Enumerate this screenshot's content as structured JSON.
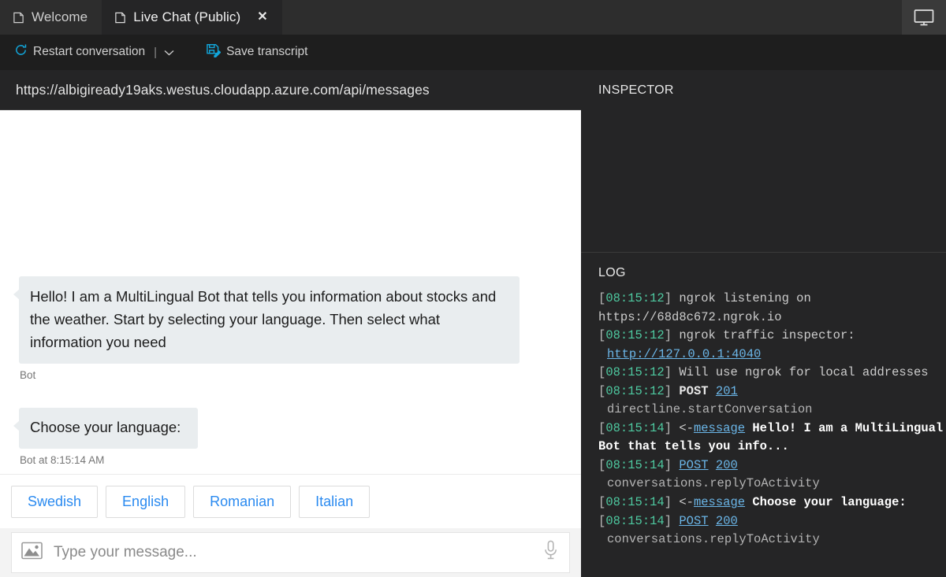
{
  "tabs": [
    {
      "label": "Welcome",
      "icon": "page-icon",
      "active": false,
      "closable": false
    },
    {
      "label": "Live Chat (Public)",
      "icon": "page-icon",
      "active": true,
      "closable": true,
      "close_glyph": "✕"
    }
  ],
  "titlebar": {
    "display_icon": "monitor-icon"
  },
  "toolbar": {
    "restart_label": "Restart conversation",
    "restart_icon": "refresh-icon",
    "separator": "|",
    "chevron": "⌄",
    "save_label": "Save transcript",
    "save_icon": "save-disk-icon",
    "accent": "#12a5d9"
  },
  "webchat": {
    "endpoint_url": "https://albigiready19aks.westus.cloudapp.azure.com/api/messages",
    "messages": [
      {
        "text": "Hello! I am a MultiLingual Bot that tells you information about stocks and the weather. Start by selecting your language. Then select what information you need",
        "meta": "Bot"
      },
      {
        "text": "Choose your language:",
        "meta": "Bot at 8:15:14 AM"
      }
    ],
    "suggested_actions": [
      "Swedish",
      "English",
      "Romanian",
      "Italian"
    ],
    "composer": {
      "upload_icon": "image-upload-icon",
      "placeholder": "Type your message...",
      "value": "",
      "mic_icon": "microphone-icon"
    }
  },
  "inspector": {
    "title": "INSPECTOR",
    "content": ""
  },
  "log": {
    "title": "LOG",
    "lines": [
      {
        "indent": false,
        "parts": [
          {
            "t": "brk",
            "v": "["
          },
          {
            "t": "ts",
            "v": "08:15:12"
          },
          {
            "t": "brk",
            "v": "]"
          },
          {
            "t": "plain",
            "v": " ngrok listening on https://68d8c672.ngrok.io"
          }
        ]
      },
      {
        "indent": false,
        "parts": [
          {
            "t": "brk",
            "v": "["
          },
          {
            "t": "ts",
            "v": "08:15:12"
          },
          {
            "t": "brk",
            "v": "]"
          },
          {
            "t": "plain",
            "v": " ngrok traffic inspector:"
          }
        ]
      },
      {
        "indent": true,
        "parts": [
          {
            "t": "lnk",
            "v": "http://127.0.0.1:4040"
          }
        ]
      },
      {
        "indent": false,
        "parts": [
          {
            "t": "brk",
            "v": "["
          },
          {
            "t": "ts",
            "v": "08:15:12"
          },
          {
            "t": "brk",
            "v": "]"
          },
          {
            "t": "plain",
            "v": " Will use ngrok for local addresses"
          }
        ]
      },
      {
        "indent": false,
        "parts": [
          {
            "t": "brk",
            "v": "["
          },
          {
            "t": "ts",
            "v": "08:15:12"
          },
          {
            "t": "brk",
            "v": "]"
          },
          {
            "t": "plain",
            "v": " "
          },
          {
            "t": "verb",
            "v": "POST"
          },
          {
            "t": "plain",
            "v": " "
          },
          {
            "t": "code",
            "v": "201"
          }
        ]
      },
      {
        "indent": true,
        "parts": [
          {
            "t": "plain",
            "v": "directline.startConversation"
          }
        ]
      },
      {
        "indent": false,
        "parts": [
          {
            "t": "brk",
            "v": "["
          },
          {
            "t": "ts",
            "v": "08:15:14"
          },
          {
            "t": "brk",
            "v": "]"
          },
          {
            "t": "plain",
            "v": " <-"
          },
          {
            "t": "code",
            "v": "message"
          },
          {
            "t": "bold",
            "v": " Hello! I am a MultiLingual Bot that tells you info..."
          }
        ]
      },
      {
        "indent": false,
        "parts": [
          {
            "t": "brk",
            "v": "["
          },
          {
            "t": "ts",
            "v": "08:15:14"
          },
          {
            "t": "brk",
            "v": "]"
          },
          {
            "t": "plain",
            "v": " "
          },
          {
            "t": "code",
            "v": "POST"
          },
          {
            "t": "plain",
            "v": " "
          },
          {
            "t": "code",
            "v": "200"
          }
        ]
      },
      {
        "indent": true,
        "parts": [
          {
            "t": "plain",
            "v": "conversations.replyToActivity"
          }
        ]
      },
      {
        "indent": false,
        "parts": [
          {
            "t": "brk",
            "v": "["
          },
          {
            "t": "ts",
            "v": "08:15:14"
          },
          {
            "t": "brk",
            "v": "]"
          },
          {
            "t": "plain",
            "v": " <-"
          },
          {
            "t": "code",
            "v": "message"
          },
          {
            "t": "bold",
            "v": " Choose your language:"
          }
        ]
      },
      {
        "indent": false,
        "parts": [
          {
            "t": "brk",
            "v": "["
          },
          {
            "t": "ts",
            "v": "08:15:14"
          },
          {
            "t": "brk",
            "v": "]"
          },
          {
            "t": "plain",
            "v": " "
          },
          {
            "t": "code",
            "v": "POST"
          },
          {
            "t": "plain",
            "v": " "
          },
          {
            "t": "code",
            "v": "200"
          }
        ]
      },
      {
        "indent": true,
        "parts": [
          {
            "t": "plain",
            "v": "conversations.replyToActivity"
          }
        ]
      }
    ]
  }
}
